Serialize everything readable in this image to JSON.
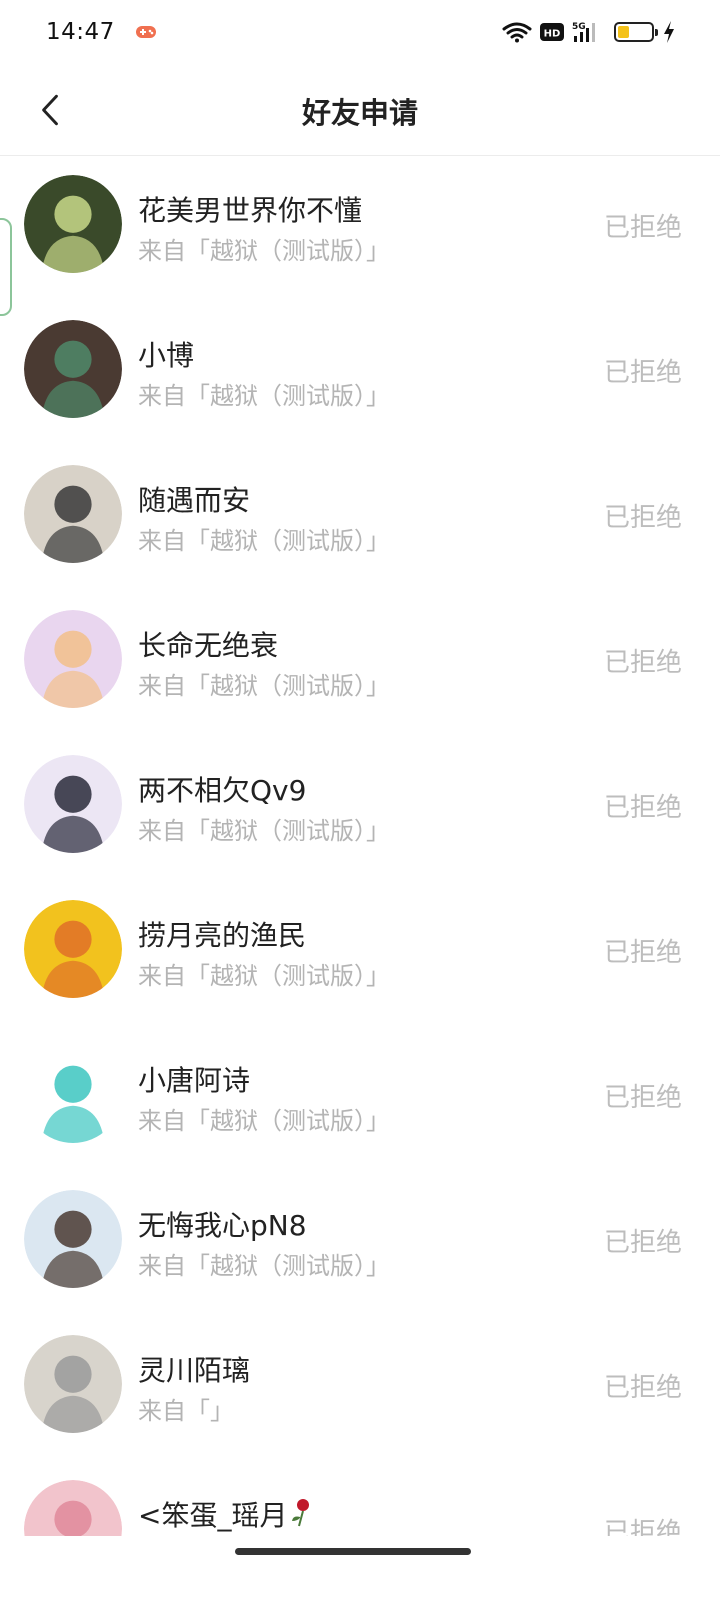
{
  "status_bar": {
    "time": "14:47",
    "game_icon": "gamepad-icon",
    "icons": [
      "wifi-icon",
      "hd-icon",
      "signal-5g-icon",
      "battery-icon",
      "charging-icon"
    ],
    "hd_label": "HD",
    "network_label": "5G",
    "battery_level": 0.35,
    "battery_color": "#f4c21a"
  },
  "header": {
    "title": "好友申请",
    "back_icon": "chevron-left-icon"
  },
  "requests": [
    {
      "name": "花美男世界你不懂",
      "source": "来自「越狱（测试版）」",
      "status": "已拒绝",
      "avatar_color": "#3a4a2a",
      "avatar_accent": "#c9d98a"
    },
    {
      "name": "小博",
      "source": "来自「越狱（测试版）」",
      "status": "已拒绝",
      "avatar_color": "#4a3a32",
      "avatar_accent": "#4f8a6a"
    },
    {
      "name": "随遇而安",
      "source": "来自「越狱（测试版）」",
      "status": "已拒绝",
      "avatar_color": "#d8d2c8",
      "avatar_accent": "#3a3a3a"
    },
    {
      "name": "长命无绝衰",
      "source": "来自「越狱（测试版）」",
      "status": "已拒绝",
      "avatar_color": "#e9d6ef",
      "avatar_accent": "#f2c08a"
    },
    {
      "name": "两不相欠Qv9",
      "source": "来自「越狱（测试版）」",
      "status": "已拒绝",
      "avatar_color": "#ece6f4",
      "avatar_accent": "#2a2a3a"
    },
    {
      "name": "捞月亮的渔民",
      "source": "来自「越狱（测试版）」",
      "status": "已拒绝",
      "avatar_color": "#f2c21e",
      "avatar_accent": "#e07028"
    },
    {
      "name": "小唐阿诗",
      "source": "来自「越狱（测试版）」",
      "status": "已拒绝",
      "avatar_color": "#ffffff",
      "avatar_accent": "#3cc6c0"
    },
    {
      "name": "无悔我心pN8",
      "source": "来自「越狱（测试版）」",
      "status": "已拒绝",
      "avatar_color": "#dbe7f1",
      "avatar_accent": "#4a3a32"
    },
    {
      "name": "灵川陌璃",
      "source": "来自「」",
      "status": "已拒绝",
      "avatar_color": "#d8d4cc",
      "avatar_accent": "#9a9a9a"
    },
    {
      "name": "<笨蛋_瑶月",
      "source": "",
      "status": "已拒绝",
      "avatar_color": "#f2c4cc",
      "avatar_accent": "#e08a9a",
      "name_icon": "rose-icon"
    }
  ]
}
